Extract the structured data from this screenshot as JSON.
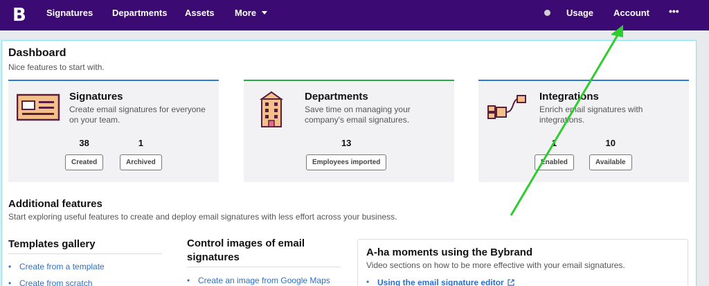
{
  "nav": {
    "logo": "B",
    "items": [
      "Signatures",
      "Departments",
      "Assets",
      "More"
    ],
    "usage": "Usage",
    "account": "Account",
    "overflow": "•••"
  },
  "dashboard": {
    "title": "Dashboard",
    "subtitle": "Nice features to start with."
  },
  "cards": [
    {
      "title": "Signatures",
      "description": "Create email signatures for everyone on your team.",
      "icon": "signature-card-icon",
      "stats": [
        {
          "value": "38",
          "label": "Created"
        },
        {
          "value": "1",
          "label": "Archived"
        }
      ]
    },
    {
      "title": "Departments",
      "description": "Save time on managing your company's email signatures.",
      "icon": "building-icon",
      "stats": [
        {
          "value": "13",
          "label": "Employees imported"
        }
      ]
    },
    {
      "title": "Integrations",
      "description": "Enrich email signatures with integrations.",
      "icon": "plug-icon",
      "stats": [
        {
          "value": "1",
          "label": "Enabled"
        },
        {
          "value": "10",
          "label": "Available"
        }
      ]
    }
  ],
  "additional": {
    "title": "Additional features",
    "subtitle": "Start exploring useful features to create and deploy email signatures with less effort across your business."
  },
  "templates": {
    "title": "Templates gallery",
    "links": [
      "Create from a template",
      "Create from scratch"
    ]
  },
  "images": {
    "title_line1": "Control images of email",
    "title_line2": "signatures",
    "links": [
      "Create an image from Google Maps"
    ]
  },
  "aha": {
    "title": "A-ha moments using the Bybrand",
    "subtitle": "Video sections on how to be more effective with your email signatures.",
    "links": [
      "Using the email signature editor"
    ]
  },
  "colors": {
    "nav_bg": "#3c0a73",
    "annotation_arrow": "#2ecc2e"
  }
}
